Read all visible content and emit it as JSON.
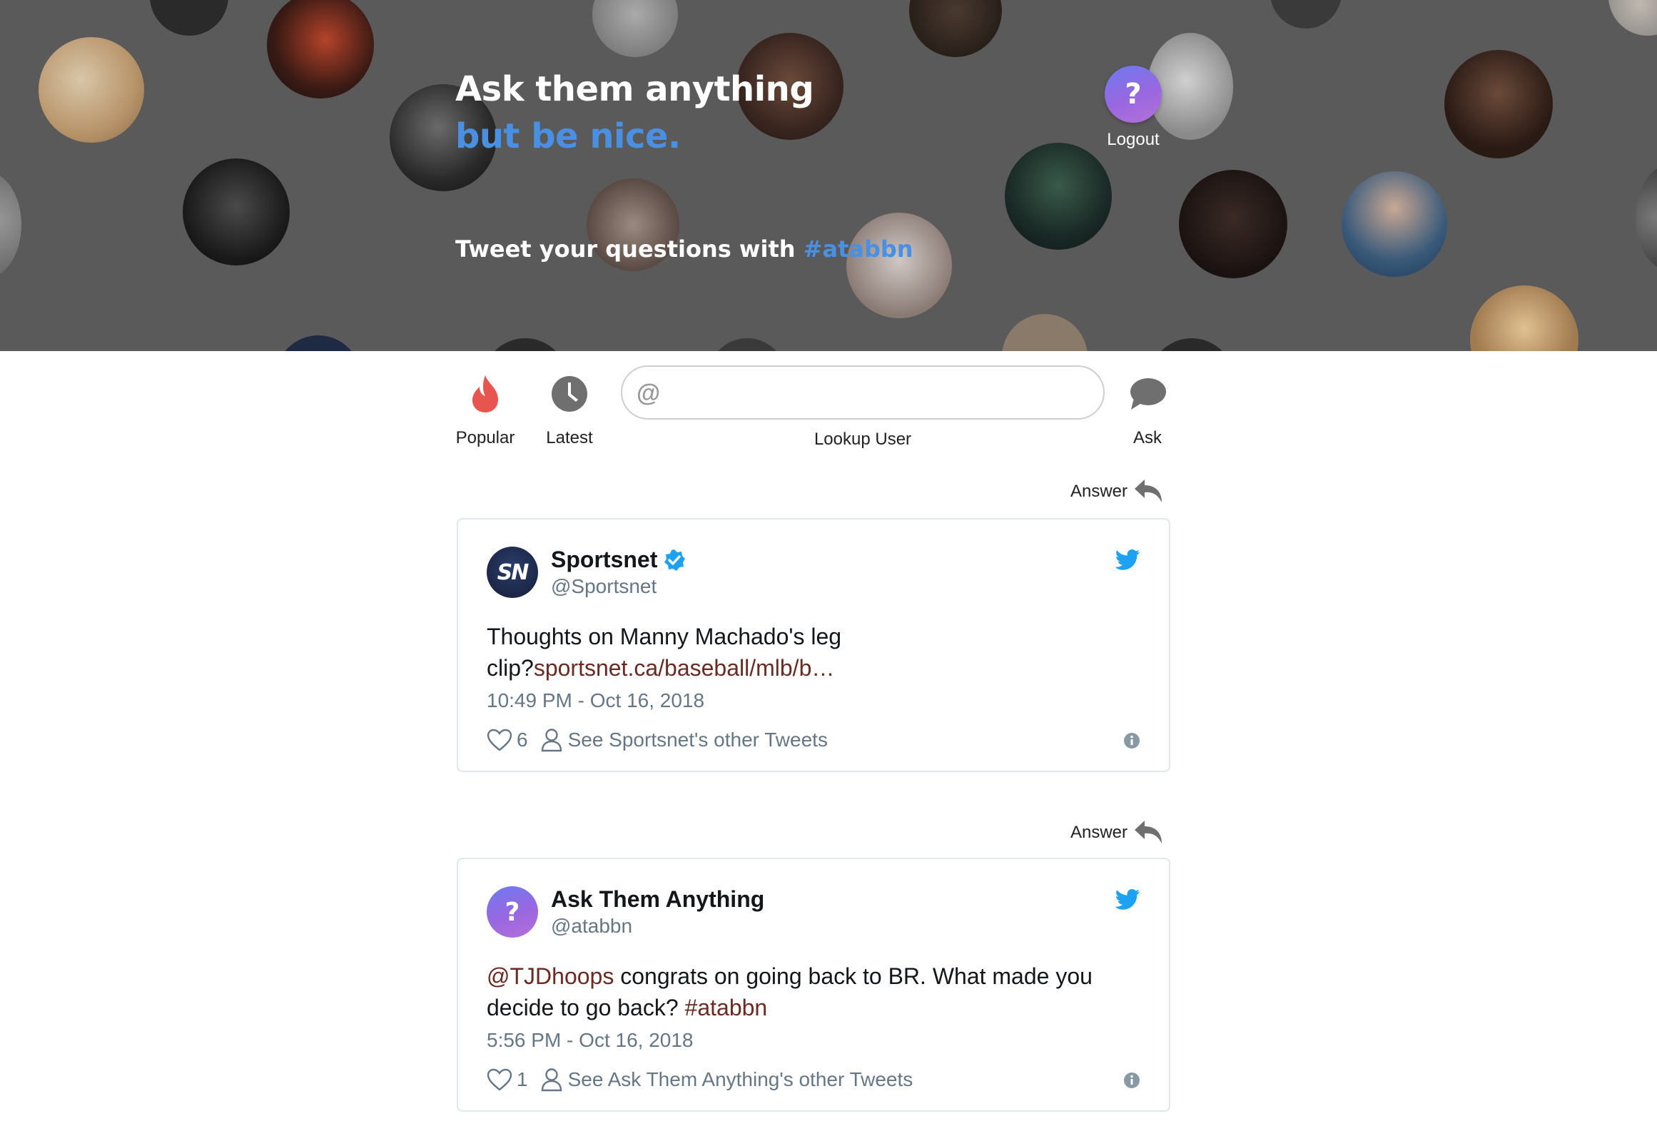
{
  "hero": {
    "title": "Ask them anything",
    "subtitle": "but be nice.",
    "tweet_prefix": "Tweet your questions with",
    "hashtag": "#atabbn",
    "logo_glyph": "?",
    "logout_label": "Logout"
  },
  "toolbar": {
    "popular_label": "Popular",
    "latest_label": "Latest",
    "lookup_label": "Lookup User",
    "lookup_prefix": "@",
    "lookup_value": "",
    "ask_label": "Ask",
    "icons": [
      "flame-icon",
      "clock-icon",
      "at-icon",
      "speech-bubble-icon"
    ]
  },
  "feed": [
    {
      "answer_label": "Answer",
      "avatar_text": "SN",
      "name": "Sportsnet",
      "verified": true,
      "handle": "@Sportsnet",
      "text_part1": "Thoughts on Manny Machado's leg clip?",
      "link_text": "sportsnet.ca/baseball/mlb/b…",
      "time": "10:49 PM - Oct 16, 2018",
      "likes": "6",
      "see_more": "See Sportsnet's other Tweets"
    },
    {
      "answer_label": "Answer",
      "avatar_text": "?",
      "name": "Ask Them Anything",
      "verified": false,
      "handle": "@atabbn",
      "mention": "@TJDhoops",
      "text_part1": " congrats on going back to BR. What made you decide to go back? ",
      "hashtag": "#atabbn",
      "time": "5:56 PM - Oct 16, 2018",
      "likes": "1",
      "see_more": "See Ask Them Anything's other Tweets"
    }
  ],
  "colors": {
    "accent_blue": "#4a90e2",
    "twitter_blue": "#1da1f2",
    "link_brown": "#6b2a22",
    "flame": "#e8554e",
    "muted": "#657786"
  }
}
